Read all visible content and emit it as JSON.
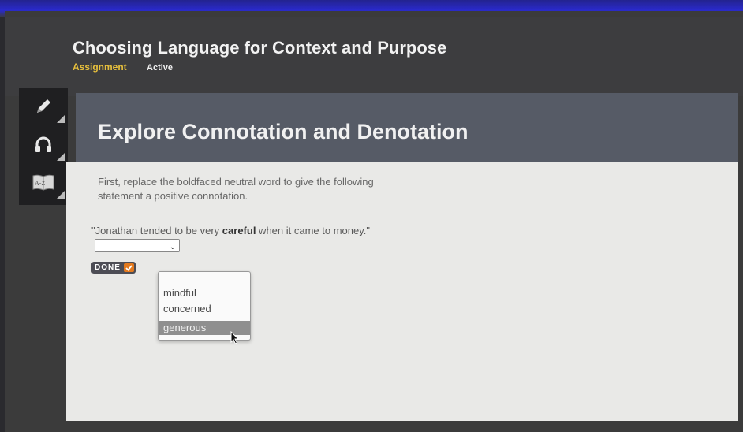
{
  "header": {
    "course_title": "Choosing Language for Context and Purpose",
    "type_label": "Assignment",
    "status_label": "Active"
  },
  "toolbar": {
    "items": [
      {
        "icon": "pencil-icon"
      },
      {
        "icon": "headphones-icon"
      },
      {
        "icon": "dictionary-icon",
        "label": "A-Z"
      }
    ]
  },
  "activity": {
    "title": "Explore Connotation and Denotation",
    "instructions": "First, replace the boldfaced neutral word to give the following statement a positive connotation.",
    "question": {
      "before": "\"Jonathan tended to be very ",
      "bold_word": "careful",
      "after": " when it came to money.\""
    },
    "done_label": "DONE",
    "select": {
      "selected_value": "",
      "options": [
        "mindful",
        "concerned",
        "generous"
      ],
      "highlighted_option": "generous"
    }
  },
  "colors": {
    "header_bg": "#3d3d3f",
    "activity_header_bg": "#565b66",
    "content_bg": "#e9e9e7",
    "accent_yellow": "#e6bf3c",
    "done_check_orange": "#e47a1e"
  }
}
